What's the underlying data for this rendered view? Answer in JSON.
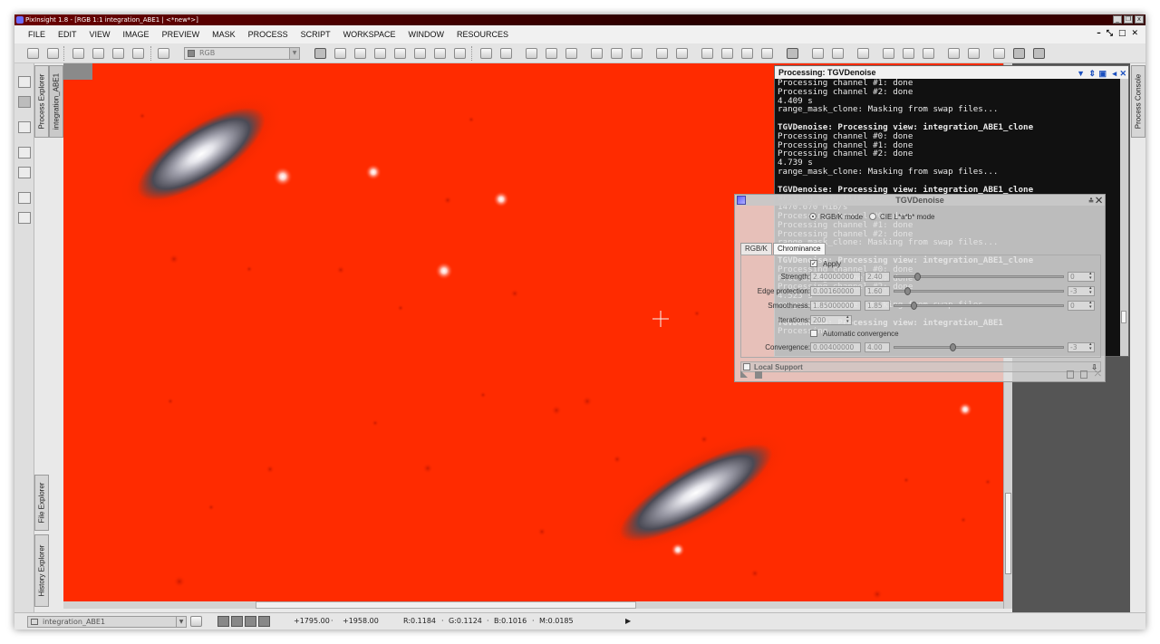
{
  "window": {
    "title": "PixInsight 1.8 - [RGB 1:1 integration_ABE1 | <*new*>]",
    "controls": [
      "_",
      "❐",
      "x"
    ]
  },
  "menu": {
    "items": [
      "FILE",
      "EDIT",
      "VIEW",
      "IMAGE",
      "PREVIEW",
      "MASK",
      "PROCESS",
      "SCRIPT",
      "WORKSPACE",
      "WINDOW",
      "RESOURCES"
    ],
    "mdi_controls": [
      "–",
      "⤡",
      "□",
      "✕"
    ]
  },
  "toolbar": {
    "channel_value": "RGB"
  },
  "side_tabs": {
    "process_explorer": "Process Explorer",
    "image_tab": "integration_ABE1",
    "file_explorer": "File Explorer",
    "history_explorer": "History Explorer",
    "process_console": "Process Console"
  },
  "console": {
    "title": "Processing: TGVDenoise",
    "lines": [
      {
        "text": "Processing channel #1: done",
        "bold": false
      },
      {
        "text": "Processing channel #2: done",
        "bold": false
      },
      {
        "text": "4.409 s",
        "bold": false
      },
      {
        "text": "range_mask_clone: Masking from swap files...",
        "bold": false
      },
      {
        "text": "",
        "bold": false
      },
      {
        "text": "TGVDenoise: Processing view: integration_ABE1_clone",
        "bold": true
      },
      {
        "text": "Processing channel #0: done",
        "bold": false
      },
      {
        "text": "Processing channel #1: done",
        "bold": false
      },
      {
        "text": "Processing channel #2: done",
        "bold": false
      },
      {
        "text": "4.739 s",
        "bold": false
      },
      {
        "text": "range_mask_clone: Masking from swap files...",
        "bold": false
      },
      {
        "text": "",
        "bold": false
      },
      {
        "text": "TGVDenoise: Processing view: integration_ABE1_clone",
        "bold": true
      },
      {
        "text": "Writing swap files...",
        "bold": false
      },
      {
        "text": "1470.670 MiB/s",
        "bold": false
      },
      {
        "text": "Processing channel #0: done",
        "bold": false
      },
      {
        "text": "Processing channel #1: done",
        "bold": false
      },
      {
        "text": "Processing channel #2: done",
        "bold": false
      },
      {
        "text": "range_mask_clone: Masking from swap files...",
        "bold": false
      },
      {
        "text": "",
        "bold": false
      },
      {
        "text": "TGVDenoise: Processing view: integration_ABE1_clone",
        "bold": true
      },
      {
        "text": "Processing channel #0: done",
        "bold": false
      },
      {
        "text": "Processing channel #1: done",
        "bold": false
      },
      {
        "text": "Processing channel #2: done",
        "bold": false
      },
      {
        "text": "4.523 s",
        "bold": false
      },
      {
        "text": "range_mask_clone: Masking from swap files...",
        "bold": false
      },
      {
        "text": "",
        "bold": false
      },
      {
        "text": "TGVDenoise: Processing view: integration_ABE1",
        "bold": true
      },
      {
        "text": "Processing...",
        "bold": false
      }
    ],
    "ghost_labels": [
      "range_mask_clone",
      "range_mask"
    ]
  },
  "dialog": {
    "title": "TGVDenoise",
    "mode_rgbk": "RGB/K mode",
    "mode_cie": "CIE L*a*b* mode",
    "tab_rgbk": "RGB/K",
    "tab_chrominance": "Chrominance",
    "apply_label": "Apply",
    "apply_checked": "✓",
    "params": [
      {
        "label": "Strength:",
        "value": "2.40000000",
        "short": "2.40",
        "exp": "0",
        "level": 0.12
      },
      {
        "label": "Edge protection:",
        "value": "0.00160000",
        "short": "1.60",
        "exp": "-3",
        "level": 0.06
      },
      {
        "label": "Smoothness:",
        "value": "1.85000000",
        "short": "1.85",
        "exp": "0",
        "level": 0.1
      }
    ],
    "iterations_label": "Iterations:",
    "iterations_value": "200",
    "auto_convergence_label": "Automatic convergence",
    "convergence": {
      "label": "Convergence:",
      "value": "0.00400000",
      "short": "4.00",
      "exp": "-3",
      "level": 0.34
    },
    "local_support": "Local Support"
  },
  "status": {
    "view_name": "integration_ABE1",
    "coord_x": "+1795.00",
    "coord_y": "+1958.00",
    "r": "R:0.1184",
    "g": "G:0.1124",
    "b": "B:0.1016",
    "m": "M:0.0185"
  },
  "colors": {
    "mask_overlay": "#ff2b00",
    "title_bar": "#6a0000",
    "console_bg": "#111111"
  }
}
